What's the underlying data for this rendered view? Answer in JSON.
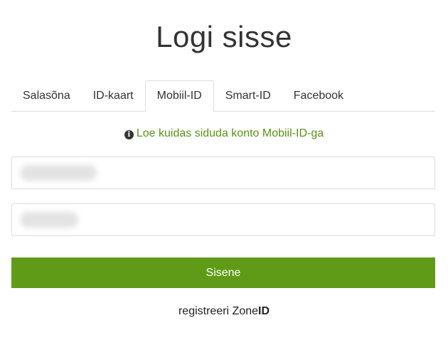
{
  "page_title": "Logi sisse",
  "tabs": [
    {
      "label": "Salasõna",
      "active": false
    },
    {
      "label": "ID-kaart",
      "active": false
    },
    {
      "label": "Mobiil-ID",
      "active": true
    },
    {
      "label": "Smart-ID",
      "active": false
    },
    {
      "label": "Facebook",
      "active": false
    }
  ],
  "help": {
    "icon": "info-circle-icon",
    "link_text": "Loe kuidas siduda konto Mobiil-ID-ga"
  },
  "form": {
    "phone_value": "",
    "idcode_value": "",
    "submit_label": "Sisene"
  },
  "register": {
    "prefix": "registreeri Zone",
    "suffix": "ID"
  },
  "colors": {
    "accent": "#5f9b16",
    "link": "#5a9414",
    "border": "#dddddd",
    "text": "#333333"
  }
}
